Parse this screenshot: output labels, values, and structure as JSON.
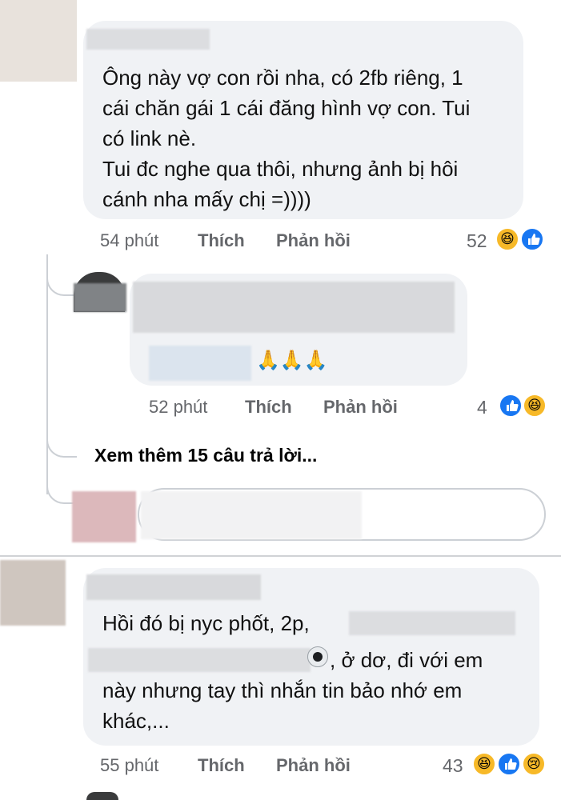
{
  "comments": [
    {
      "text_lines": [
        "Ông này vợ con rồi nha, có 2fb riêng, 1",
        "cái chăn gái 1 cái đăng hình vợ con. Tui",
        "có link nè.",
        "Tui đc nghe qua thôi, nhưng ảnh bị hôi",
        "cánh nha mấy chị =))))"
      ],
      "time": "54 phút",
      "like_label": "Thích",
      "reply_label": "Phản hồi",
      "reaction_count": "52",
      "reactions": [
        "haha-icon",
        "like-icon"
      ]
    },
    {
      "text_emojis": "🙏🙏🙏",
      "time": "52 phút",
      "like_label": "Thích",
      "reply_label": "Phản hồi",
      "reaction_count": "4",
      "reactions": [
        "like-icon",
        "haha-icon"
      ]
    },
    {
      "text_lines": [
        "Hồi đó bị nyc phốt, 2p,",
        ", ở dơ, đi với em",
        "này nhưng tay thì nhắn tin bảo nhớ em",
        "khác,..."
      ],
      "time": "55 phút",
      "like_label": "Thích",
      "reply_label": "Phản hồi",
      "reaction_count": "43",
      "reactions": [
        "haha-icon",
        "like-icon",
        "sad-icon"
      ]
    }
  ],
  "see_more_replies": "Xem thêm 15 câu trả lời...",
  "colors": {
    "bubble": "#f0f2f5",
    "meta_text": "#65676b",
    "like_blue": "#1877f2",
    "haha_yellow": "#f7b928"
  }
}
